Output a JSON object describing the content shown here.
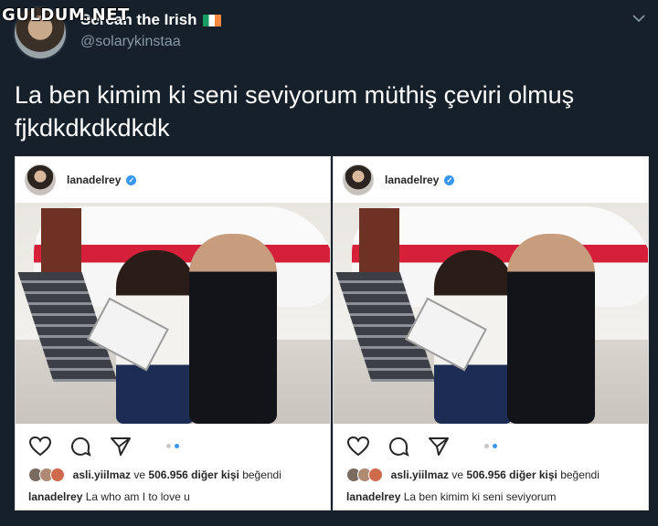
{
  "watermark": "GULDUM.NET",
  "tweet": {
    "display_name": "Sercan the Irish",
    "handle": "@solarykinstaa",
    "text": "La ben kimim ki seni seviyorum müthiş çeviri olmuş fjkdkdkdkdkdk"
  },
  "posts": [
    {
      "username": "lanadelrey",
      "liker": "asli.yiilmaz",
      "likes_join": "ve",
      "likes_count": "506.956",
      "likes_other": "diğer kişi",
      "likes_suffix": "beğendi",
      "caption_user": "lanadelrey",
      "caption_text": "La who am I to love u"
    },
    {
      "username": "lanadelrey",
      "liker": "asli.yiilmaz",
      "likes_join": "ve",
      "likes_count": "506.956",
      "likes_other": "diğer kişi",
      "likes_suffix": "beğendi",
      "caption_user": "lanadelrey",
      "caption_text": "La ben kimim ki seni seviyorum"
    }
  ],
  "icons": [
    "heart-icon",
    "comment-icon",
    "share-icon",
    "verified-icon",
    "chevron-down-icon"
  ],
  "colors": {
    "background": "#15202b",
    "handle": "#8899a6",
    "ig_blue": "#3897f0"
  }
}
